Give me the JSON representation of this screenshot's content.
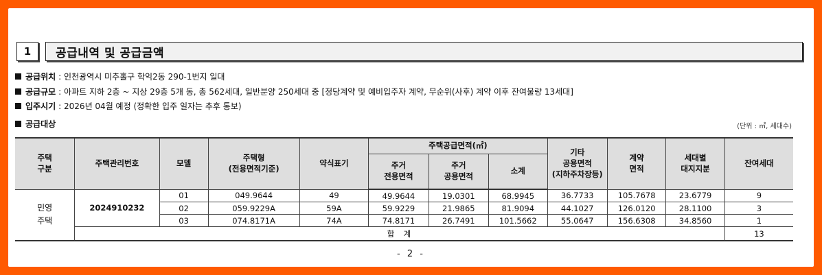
{
  "section": {
    "number": "1",
    "title": "공급내역 및 공급금액"
  },
  "info": [
    {
      "label": "공급위치",
      "value": ": 인천광역시 미추홀구 학익2동 290-1번지 일대"
    },
    {
      "label": "공급규모",
      "value": ": 아파트 지하 2층 ~ 지상 29층 5개 동, 총 562세대, 일반분양 250세대 중 [정당계약 및 예비입주자 계약, 무순위(사후) 계약 이후 잔여물량 13세대]"
    },
    {
      "label": "입주시기",
      "value": ": 2026년 04월 예정 (정확한 입주 일자는 추후 통보)"
    },
    {
      "label": "공급대상",
      "value": ""
    }
  ],
  "unit_note": "(단위 : ㎡, 세대수)",
  "table": {
    "headers": {
      "housing_type": "주택\n구분",
      "mgmt_no": "주택관리번호",
      "model": "모델",
      "house_type": "주택형\n(전용면적기준)",
      "abbr": "약식표기",
      "supply_area": "주택공급면적(㎡)",
      "exclusive": "주거\n전용면적",
      "common": "주거\n공용면적",
      "subtotal": "소계",
      "other_common": "기타\n공용면적\n(지하주차장등)",
      "contract_area": "계약\n면적",
      "land_share": "세대별\n대지지분",
      "remaining": "잔여세대"
    },
    "group_label": "민영\n주택",
    "mgmt_no_value": "2024910232",
    "rows": [
      {
        "model": "01",
        "house_type": "049.9644",
        "abbr": "49",
        "exclusive": "49.9644",
        "common": "19.0301",
        "subtotal": "68.9945",
        "other_common": "36.7733",
        "contract_area": "105.7678",
        "land_share": "23.6779",
        "remaining": "9"
      },
      {
        "model": "02",
        "house_type": "059.9229A",
        "abbr": "59A",
        "exclusive": "59.9229",
        "common": "21.9865",
        "subtotal": "81.9094",
        "other_common": "44.1027",
        "contract_area": "126.0120",
        "land_share": "28.1100",
        "remaining": "3"
      },
      {
        "model": "03",
        "house_type": "074.8171A",
        "abbr": "74A",
        "exclusive": "74.8171",
        "common": "26.7491",
        "subtotal": "101.5662",
        "other_common": "55.0647",
        "contract_area": "156.6308",
        "land_share": "34.8560",
        "remaining": "1"
      }
    ],
    "total_label": "합  계",
    "total_value": "13"
  },
  "page_number": "- 2 -"
}
